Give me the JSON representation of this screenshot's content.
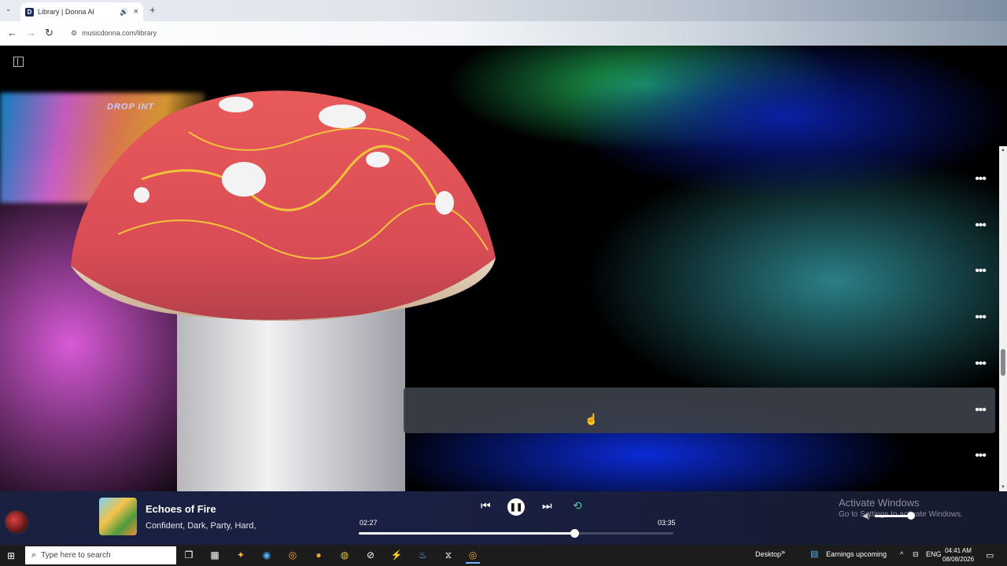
{
  "browser": {
    "tab_title": "Library | Donna AI",
    "tab_favicon_letter": "D",
    "url": "musicdonna.com/library"
  },
  "app": {
    "promo_text": "DROP INT",
    "rows": [
      {
        "id": 1,
        "hover": false
      },
      {
        "id": 2,
        "hover": false
      },
      {
        "id": 3,
        "hover": false
      },
      {
        "id": 4,
        "hover": false
      },
      {
        "id": 5,
        "hover": false
      },
      {
        "id": 6,
        "hover": true
      },
      {
        "id": 7,
        "hover": false
      }
    ]
  },
  "player": {
    "title": "Echoes of Fire",
    "tags": "Confident, Dark, Party, Hard,",
    "current_time": "02:27",
    "total_time": "03:35",
    "progress_fraction": 0.685,
    "volume_fraction": 0.9
  },
  "watermark": {
    "line1": "Activate Windows",
    "line2": "Go to Settings to activate Windows."
  },
  "taskbar": {
    "search_placeholder": "Type here to search",
    "desktop_label": "Desktop",
    "earnings_label": "Earnings upcoming",
    "lang": "ENG",
    "time": "04:41 AM",
    "date": "08/08/2026"
  },
  "colors": {
    "player_bg": "#1a2040",
    "hover_row": "#3c4048"
  }
}
